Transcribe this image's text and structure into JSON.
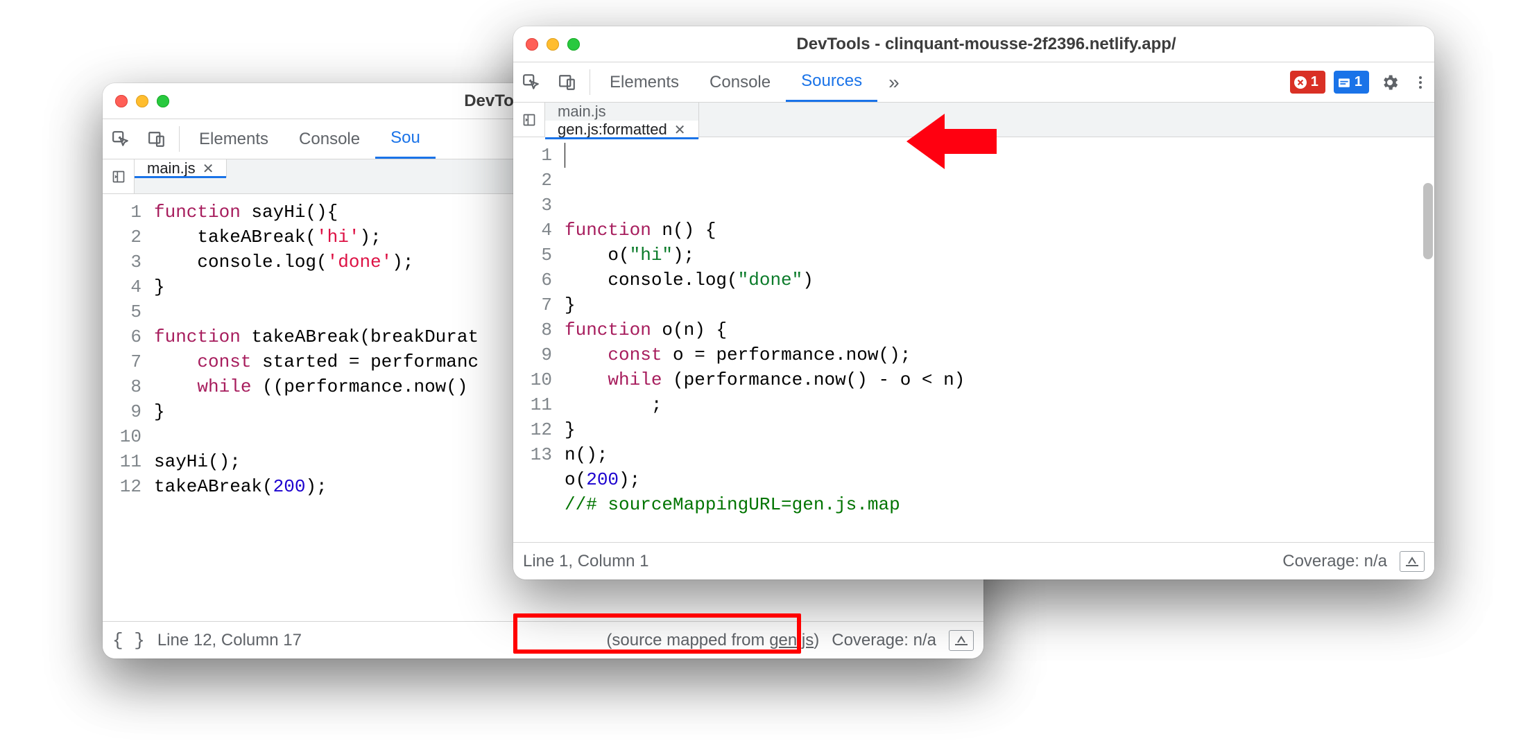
{
  "windows": {
    "left": {
      "title": "DevTools - clinquant-m",
      "panelTabs": {
        "elements": "Elements",
        "console": "Console",
        "sources": "Sou"
      },
      "fileTabs": [
        {
          "name": "main.js",
          "active": true,
          "closable": true
        }
      ],
      "code": {
        "lines": [
          {
            "n": 1,
            "html": "<span class='kw'>function</span> sayHi(){"
          },
          {
            "n": 2,
            "html": "    takeABreak(<span class='str1'>'hi'</span>);"
          },
          {
            "n": 3,
            "html": "    console.log(<span class='str1'>'done'</span>);"
          },
          {
            "n": 4,
            "html": "}"
          },
          {
            "n": 5,
            "html": ""
          },
          {
            "n": 6,
            "html": "<span class='kw'>function</span> takeABreak(breakDurat"
          },
          {
            "n": 7,
            "html": "    <span class='kw'>const</span> started = performanc"
          },
          {
            "n": 8,
            "html": "    <span class='kw'>while</span> ((performance.now() "
          },
          {
            "n": 9,
            "html": "}"
          },
          {
            "n": 10,
            "html": ""
          },
          {
            "n": 11,
            "html": "sayHi();"
          },
          {
            "n": 12,
            "html": "takeABreak(<span class='num'>200</span>);"
          }
        ]
      },
      "status": {
        "formatBtn": "{ }",
        "position": "Line 12, Column 17",
        "sourceMapped": "(source mapped from ",
        "sourceMappedFile": "gen.js",
        "sourceMappedClose": ")",
        "coverage": "Coverage: n/a"
      }
    },
    "right": {
      "title": "DevTools - clinquant-mousse-2f2396.netlify.app/",
      "panelTabs": {
        "elements": "Elements",
        "console": "Console",
        "sources": "Sources"
      },
      "errorBadge": "1",
      "infoBadge": "1",
      "fileTabs": [
        {
          "name": "main.js",
          "active": false,
          "closable": false
        },
        {
          "name": "gen.js:formatted",
          "active": true,
          "closable": true
        }
      ],
      "code": {
        "lines": [
          {
            "n": 1,
            "html": "<span class='kw'>function</span> n() {"
          },
          {
            "n": 2,
            "html": "    o(<span class='str2'>\"hi\"</span>);"
          },
          {
            "n": 3,
            "html": "    console.log(<span class='str2'>\"done\"</span>)"
          },
          {
            "n": 4,
            "html": "}"
          },
          {
            "n": 5,
            "html": "<span class='kw'>function</span> o(n) {"
          },
          {
            "n": 6,
            "html": "    <span class='kw'>const</span> o = performance.now();"
          },
          {
            "n": 7,
            "html": "    <span class='kw'>while</span> (performance.now() - o &lt; n)"
          },
          {
            "n": 8,
            "html": "        ;"
          },
          {
            "n": 9,
            "html": "}"
          },
          {
            "n": 10,
            "html": "n();"
          },
          {
            "n": 11,
            "html": "o(<span class='num'>200</span>);"
          },
          {
            "n": 12,
            "html": "<span class='com'>//# sourceMappingURL=gen.js.map</span>"
          },
          {
            "n": 13,
            "html": ""
          }
        ]
      },
      "status": {
        "position": "Line 1, Column 1",
        "coverage": "Coverage: n/a"
      }
    }
  }
}
